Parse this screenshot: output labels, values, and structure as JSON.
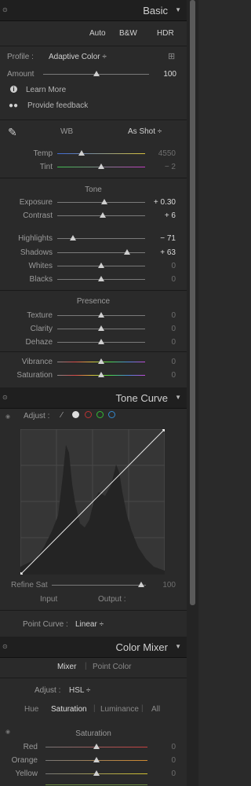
{
  "basic": {
    "title": "Basic",
    "auto": "Auto",
    "bw": "B&W",
    "hdr": "HDR",
    "profile_label": "Profile :",
    "profile_value": "Adaptive Color ÷",
    "amount_label": "Amount",
    "amount_value": "100",
    "learn_more": "Learn More",
    "feedback": "Provide feedback",
    "wb_label": "WB",
    "wb_value": "As Shot ÷",
    "temp_label": "Temp",
    "temp_value": "4550",
    "tint_label": "Tint",
    "tint_value": "− 2",
    "tone_heading": "Tone",
    "exposure_label": "Exposure",
    "exposure_value": "+ 0.30",
    "contrast_label": "Contrast",
    "contrast_value": "+ 6",
    "highlights_label": "Highlights",
    "highlights_value": "− 71",
    "shadows_label": "Shadows",
    "shadows_value": "+ 63",
    "whites_label": "Whites",
    "whites_value": "0",
    "blacks_label": "Blacks",
    "blacks_value": "0",
    "presence_heading": "Presence",
    "texture_label": "Texture",
    "texture_value": "0",
    "clarity_label": "Clarity",
    "clarity_value": "0",
    "dehaze_label": "Dehaze",
    "dehaze_value": "0",
    "vibrance_label": "Vibrance",
    "vibrance_value": "0",
    "saturation_label": "Saturation",
    "saturation_value": "0"
  },
  "tone_curve": {
    "title": "Tone Curve",
    "adjust_label": "Adjust :",
    "refine_label": "Refine Sat",
    "refine_value": "100",
    "input_label": "Input",
    "output_label": "Output :",
    "point_curve_label": "Point Curve :",
    "point_curve_value": "Linear ÷"
  },
  "color_mixer": {
    "title": "Color Mixer",
    "mixer_tab": "Mixer",
    "point_color_tab": "Point Color",
    "adjust_label": "Adjust :",
    "adjust_value": "HSL ÷",
    "hue_tab": "Hue",
    "saturation_tab": "Saturation",
    "luminance_tab": "Luminance",
    "all_tab": "All",
    "saturation_heading": "Saturation",
    "red_label": "Red",
    "red_value": "0",
    "orange_label": "Orange",
    "orange_value": "0",
    "yellow_label": "Yellow",
    "yellow_value": "0"
  },
  "colors": {
    "accent": "#3b82f6"
  }
}
